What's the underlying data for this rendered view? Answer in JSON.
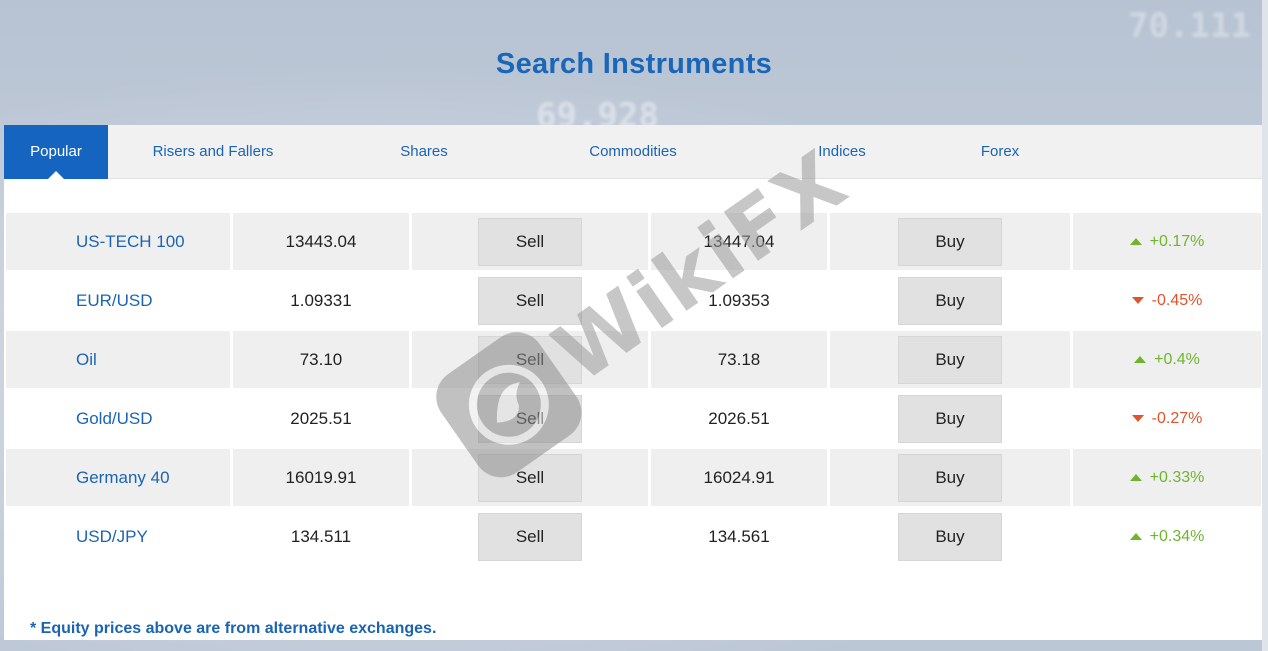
{
  "background": {
    "ticker_numbers": [
      "69.928",
      "70.111"
    ]
  },
  "page": {
    "title": "Search Instruments",
    "footnote": "* Equity prices above are from alternative exchanges."
  },
  "tabs": [
    {
      "label": "Popular",
      "active": true
    },
    {
      "label": "Risers and Fallers",
      "active": false
    },
    {
      "label": "Shares",
      "active": false
    },
    {
      "label": "Commodities",
      "active": false
    },
    {
      "label": "Indices",
      "active": false
    },
    {
      "label": "Forex",
      "active": false
    }
  ],
  "buttons": {
    "sell_label": "Sell",
    "buy_label": "Buy"
  },
  "instruments": [
    {
      "name": "US-TECH 100",
      "sell": "13443.04",
      "buy": "13447.04",
      "change": "+0.17%",
      "direction": "up"
    },
    {
      "name": "EUR/USD",
      "sell": "1.09331",
      "buy": "1.09353",
      "change": "-0.45%",
      "direction": "down"
    },
    {
      "name": "Oil",
      "sell": "73.10",
      "buy": "73.18",
      "change": "+0.4%",
      "direction": "up"
    },
    {
      "name": "Gold/USD",
      "sell": "2025.51",
      "buy": "2026.51",
      "change": "-0.27%",
      "direction": "down"
    },
    {
      "name": "Germany 40",
      "sell": "16019.91",
      "buy": "16024.91",
      "change": "+0.33%",
      "direction": "up"
    },
    {
      "name": "USD/JPY",
      "sell": "134.511",
      "buy": "134.561",
      "change": "+0.34%",
      "direction": "up"
    }
  ],
  "colors": {
    "accent": "#1565c0",
    "link": "#1b64b4",
    "up": "#6fb52c",
    "down": "#e0532c"
  },
  "icons": {
    "up": "triangle-up-icon",
    "down": "triangle-down-icon",
    "watermark": "wikifx-logo"
  },
  "watermark": {
    "text": "WikiFX"
  }
}
